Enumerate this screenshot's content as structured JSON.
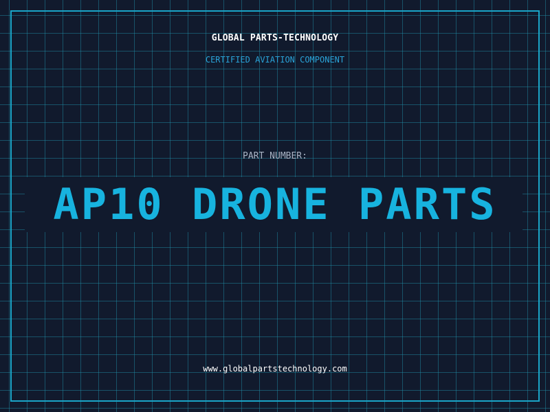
{
  "header": {
    "company": "GLOBAL PARTS-TECHNOLOGY",
    "subtitle": "CERTIFIED AVIATION COMPONENT"
  },
  "main": {
    "part_label": "PART NUMBER:",
    "part_number": "AP10 DRONE PARTS"
  },
  "footer": {
    "website": "www.globalpartstechnology.com"
  },
  "colors": {
    "background": "#111a2d",
    "grid": "#2296af",
    "accent": "#17b3df",
    "frame": "#1aa6c9",
    "text_primary": "#ffffff",
    "text_muted": "#a8b3c4"
  }
}
